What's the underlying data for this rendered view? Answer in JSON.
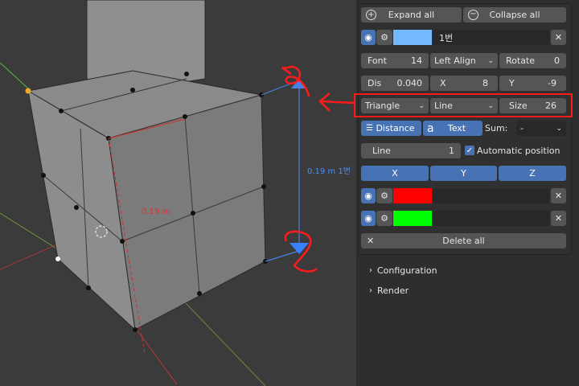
{
  "viewport": {
    "dimension_label": "0.19 m",
    "dimension_label_2": "0.19 m 1번"
  },
  "toolbar": {
    "expand_all": "Expand all",
    "collapse_all": "Collapse all"
  },
  "measure1": {
    "name": "1번",
    "color": "#74b9ff"
  },
  "font_row": {
    "font_label": "Font",
    "font_size": "14",
    "align": "Left Align",
    "rotate_label": "Rotate",
    "rotate_value": "0"
  },
  "dis_row": {
    "dis_label": "Dis",
    "dis_value": "0.040",
    "x_label": "X",
    "x_value": "8",
    "y_label": "Y",
    "y_value": "-9"
  },
  "arrow_row": {
    "shape": "Triangle",
    "style": "Line",
    "size_label": "Size",
    "size_value": "26"
  },
  "mode_row": {
    "distance": "Distance",
    "text": "Text",
    "sum_label": "Sum:",
    "sum_value": "-"
  },
  "line_row": {
    "line_label": "Line",
    "line_value": "1",
    "auto_position": "Automatic position"
  },
  "axes": {
    "x": "X",
    "y": "Y",
    "z": "Z"
  },
  "measure2": {
    "color": "#ff0000"
  },
  "measure3": {
    "color": "#00ff00"
  },
  "delete_all": "Delete all",
  "subpanels": {
    "configuration": "Configuration",
    "render": "Render"
  }
}
